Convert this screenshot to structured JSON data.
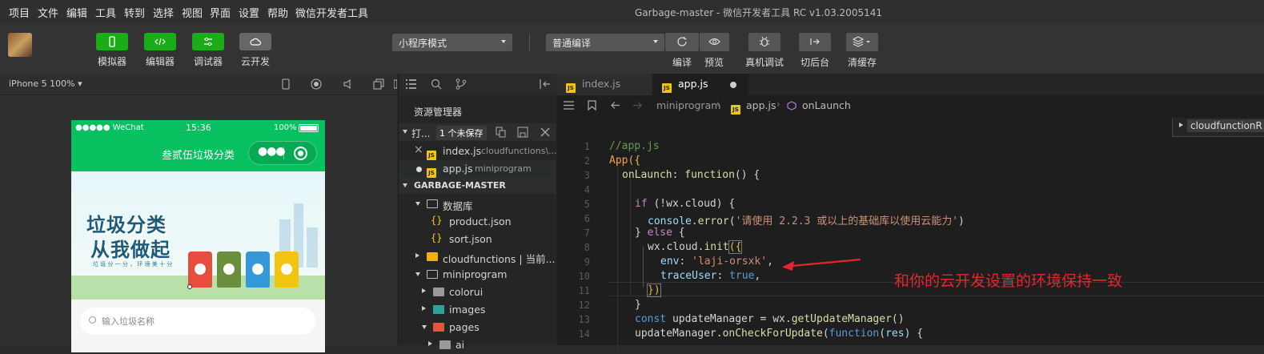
{
  "menubar": {
    "items": [
      "项目",
      "文件",
      "编辑",
      "工具",
      "转到",
      "选择",
      "视图",
      "界面",
      "设置",
      "帮助",
      "微信开发者工具"
    ],
    "title": "Garbage-master - 微信开发者工具 RC v1.03.2005141"
  },
  "toolbar": {
    "simulator": "模拟器",
    "editor": "编辑器",
    "debugger": "调试器",
    "cloud": "云开发",
    "mode_select": "小程序模式",
    "compile_select": "普通编译",
    "compile": "编译",
    "preview": "预览",
    "real_debug": "真机调试",
    "background": "切后台",
    "clear_cache": "清缓存"
  },
  "simulator": {
    "device": "iPhone 5 100% ▾",
    "status": {
      "carrier": "●●●●● WeChat",
      "time": "15:36",
      "battery": "100%"
    },
    "nav_title": "叁贰伍垃圾分类",
    "banner_line1": "垃圾分类",
    "banner_line2": "从我做起",
    "banner_sub": "垃 圾 分 一 分 ， 环 境 美 十 分",
    "search_placeholder": "输入垃圾名称"
  },
  "explorer": {
    "title": "资源管理器",
    "open_label": "打...",
    "unsaved": "1 个未保存",
    "open_files": [
      {
        "name": "index.js",
        "path": "cloudfunctions\\..."
      },
      {
        "name": "app.js",
        "path": "miniprogram"
      }
    ],
    "project": "GARBAGE-MASTER",
    "tree": [
      {
        "label": "数据库",
        "type": "folder-open"
      },
      {
        "label": "product.json",
        "type": "json"
      },
      {
        "label": "sort.json",
        "type": "json"
      },
      {
        "label": "cloudfunctions | 当前...",
        "type": "folder"
      },
      {
        "label": "miniprogram",
        "type": "folder-open"
      },
      {
        "label": "colorui",
        "type": "folder"
      },
      {
        "label": "images",
        "type": "folder"
      },
      {
        "label": "pages",
        "type": "folder-open"
      },
      {
        "label": "ai",
        "type": "folder"
      }
    ]
  },
  "editor": {
    "tabs": [
      {
        "label": "index.js"
      },
      {
        "label": "app.js"
      }
    ],
    "breadcrumb": {
      "root": "miniprogram",
      "file": "app.js",
      "symbol": "onLaunch"
    },
    "peek": "cloudfunctionR",
    "annotation": "和你的云开发设置的环境保持一致",
    "line_numbers": [
      "1",
      "2",
      "3",
      "4",
      "5",
      "6",
      "7",
      "8",
      "9",
      "10",
      "11",
      "12",
      "13",
      "14"
    ],
    "code": {
      "l1": "//app.js",
      "l2a": "App(",
      "l2b": "{",
      "l3a": "onLaunch",
      "l3b": ": ",
      "l3c": "function",
      "l3d": "() {",
      "l5a": "if",
      "l5b": " (!wx.cloud) {",
      "l6a": "console.",
      "l6b": "error",
      "l6c": "(",
      "l6d": "'请使用 2.2.3 或以上的基础库以使用云能力'",
      "l6e": ")",
      "l7a": "} ",
      "l7b": "else",
      "l7c": " {",
      "l8a": "wx.cloud.",
      "l8b": "init",
      "l8c": "({",
      "l9a": "env",
      "l9b": ": ",
      "l9c": "'laji-orsxk'",
      "l9d": ",",
      "l10a": "traceUser",
      "l10b": ": ",
      "l10c": "true",
      "l10d": ",",
      "l11": "})",
      "l12": "}",
      "l13a": "const",
      "l13b": " updateManager = wx.",
      "l13c": "getUpdateManager",
      "l13d": "()",
      "l14a": "updateManager.",
      "l14b": "onCheckForUpdate",
      "l14c": "(",
      "l14d": "function",
      "l14e": "(",
      "l14f": "res",
      "l14g": ") {"
    }
  },
  "colors": {
    "accent_green": "#1aad19",
    "annotation_red": "#e8242c",
    "wechat_green": "#07c160"
  }
}
